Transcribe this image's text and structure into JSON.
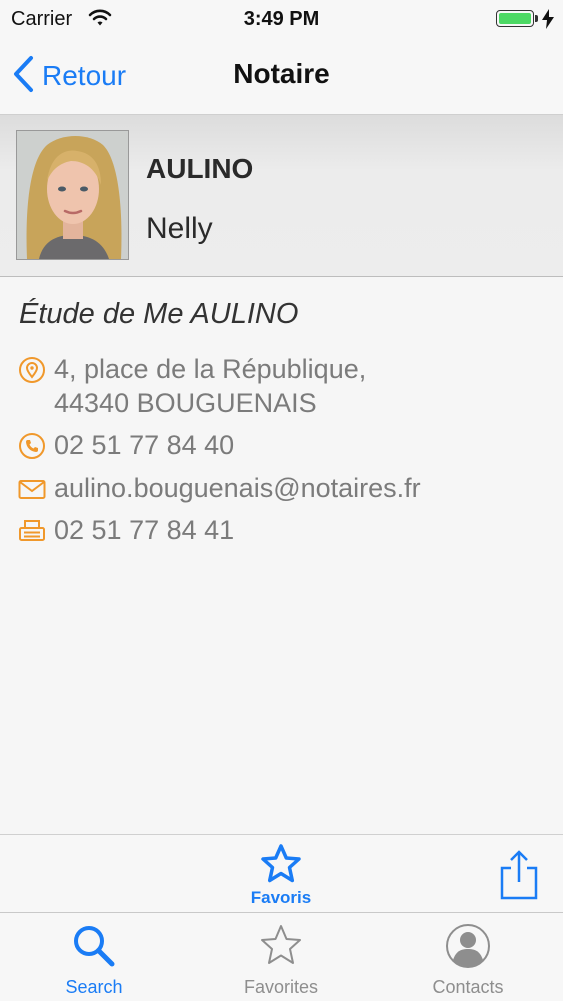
{
  "status": {
    "carrier": "Carrier",
    "time": "3:49 PM",
    "battery": 1.0
  },
  "nav": {
    "back_label": "Retour",
    "title": "Notaire"
  },
  "person": {
    "last_name": "AULINO",
    "first_name": "Nelly"
  },
  "office": {
    "name": "Étude de Me AULINO",
    "address_line1": "4, place de la République,",
    "address_line2": "44340 BOUGUENAIS",
    "phone": "02 51 77 84 40",
    "email": "aulino.bouguenais@notaires.fr",
    "fax": "02 51 77 84 41"
  },
  "toolbar": {
    "favorite_label": "Favoris"
  },
  "tabs": [
    {
      "label": "Search",
      "icon": "search-icon",
      "active": true
    },
    {
      "label": "Favorites",
      "icon": "star-icon",
      "active": false
    },
    {
      "label": "Contacts",
      "icon": "contacts-icon",
      "active": false
    }
  ],
  "colors": {
    "accent": "#1a7cf5",
    "icon_orange": "#f0982b",
    "inactive": "#8e8e8e"
  }
}
